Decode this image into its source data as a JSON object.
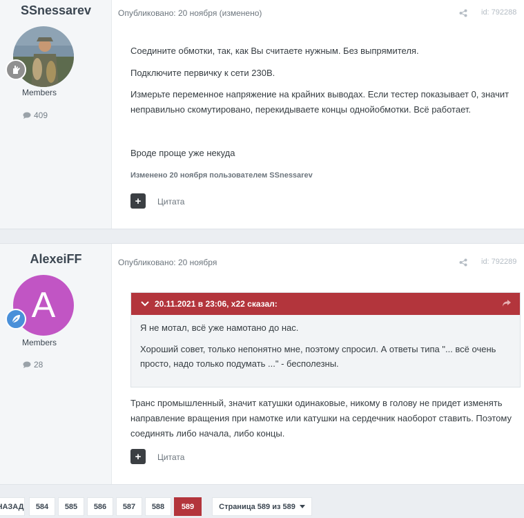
{
  "post1": {
    "author": "SSnessarev",
    "group": "Members",
    "post_count": "409",
    "published": "Опубликовано: 20 ноября (изменено)",
    "post_id": "id: 792288",
    "paragraphs": [
      "Соедините обмотки, так, как Вы считаете нужным.  Без выпрямителя.",
      "Подключите первичку к сети 230В.",
      "Измерьте переменное напряжение на крайних выводах. Если тестер показывает 0, значит неправильно скомутировано, перекидываете концы однойобмотки. Всё работает.",
      "Вроде проще уже некуда"
    ],
    "edited_note": "Изменено 20 ноября пользователем SSnessarev",
    "quote_label": "Цитата"
  },
  "post2": {
    "author": "AlexeiFF",
    "avatar_letter": "A",
    "group": "Members",
    "post_count": "28",
    "published": "Опубликовано: 20 ноября",
    "post_id": "id: 792289",
    "quote": {
      "header": "20.11.2021 в 23:06, x22 сказал:",
      "lines": [
        "Я не мотал, всё уже намотано до нас.",
        "Хороший совет, только непонятно мне, поэтому спросил. А ответы типа \"... всё очень просто, надо только подумать ...\" - бесполезны."
      ]
    },
    "text": "Транс промышленный, значит катушки одинаковые, никому в голову не придет изменять направление вращения при намотке или катушки на сердечник наоборот ставить. Поэтому соединять либо начала, либо концы.",
    "quote_label": "Цитата"
  },
  "pagination": {
    "back": "НАЗАД",
    "pages": [
      "584",
      "585",
      "586",
      "587",
      "588",
      "589"
    ],
    "active": "589",
    "jump": "Страница 589 из 589"
  },
  "colors": {
    "accent": "#b3353c",
    "avatar2": "#c155c4",
    "badge1": "#909090",
    "badge2": "#4a90d9"
  }
}
